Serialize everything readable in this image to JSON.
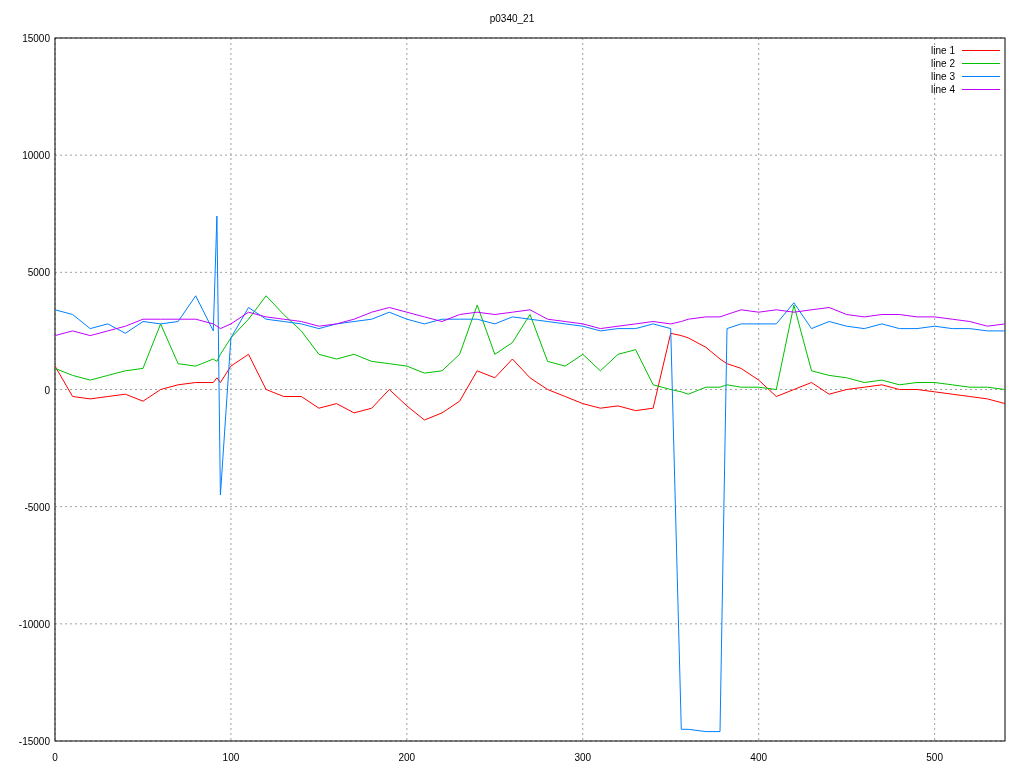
{
  "plot": {
    "chart_data": {
      "type": "line",
      "title": "p0340_21",
      "x": [
        0,
        10,
        20,
        30,
        40,
        50,
        60,
        70,
        80,
        90,
        92,
        94,
        100,
        110,
        120,
        130,
        140,
        150,
        160,
        170,
        180,
        190,
        200,
        210,
        220,
        230,
        240,
        250,
        260,
        270,
        280,
        290,
        300,
        310,
        320,
        330,
        340,
        350,
        356,
        360,
        370,
        378,
        382,
        390,
        400,
        410,
        420,
        430,
        440,
        450,
        460,
        470,
        480,
        490,
        500,
        510,
        520,
        530,
        540
      ],
      "grid": true,
      "legend": true,
      "xlim": [
        0,
        540
      ],
      "ylim": [
        -15000,
        15000
      ],
      "xticks": [
        0,
        100,
        200,
        300,
        400,
        500
      ],
      "yticks": [
        -15000,
        -10000,
        -5000,
        0,
        5000,
        10000,
        15000
      ],
      "series": [
        {
          "name": "line 1",
          "color": "#ff0000",
          "values": [
            1000,
            -300,
            -400,
            -300,
            -200,
            -500,
            0,
            200,
            300,
            300,
            500,
            300,
            1000,
            1500,
            0,
            -300,
            -300,
            -800,
            -600,
            -1000,
            -800,
            0,
            -700,
            -1300,
            -1000,
            -500,
            800,
            500,
            1300,
            500,
            0,
            -300,
            -600,
            -800,
            -700,
            -900,
            -800,
            2400,
            2300,
            2200,
            1800,
            1300,
            1100,
            900,
            400,
            -300,
            0,
            300,
            -200,
            0,
            100,
            200,
            0,
            0,
            -100,
            -200,
            -300,
            -400,
            -600
          ]
        },
        {
          "name": "line 2",
          "color": "#00c000",
          "values": [
            900,
            600,
            400,
            600,
            800,
            900,
            2800,
            1100,
            1000,
            1300,
            1200,
            1500,
            2200,
            3000,
            4000,
            3200,
            2500,
            1500,
            1300,
            1500,
            1200,
            1100,
            1000,
            700,
            800,
            1500,
            3600,
            1500,
            2000,
            3200,
            1200,
            1000,
            1500,
            800,
            1500,
            1700,
            200,
            0,
            -100,
            -200,
            100,
            100,
            200,
            100,
            100,
            0,
            3600,
            800,
            600,
            500,
            300,
            400,
            200,
            300,
            300,
            200,
            100,
            100,
            0
          ]
        },
        {
          "name": "line 3",
          "color": "#0080ff",
          "values": [
            3400,
            3200,
            2600,
            2800,
            2400,
            2900,
            2800,
            2900,
            4000,
            2500,
            7400,
            -4500,
            2200,
            3500,
            3000,
            2900,
            2800,
            2600,
            2800,
            2900,
            3000,
            3300,
            3000,
            2800,
            3000,
            3000,
            3000,
            2800,
            3100,
            3000,
            2900,
            2800,
            2700,
            2500,
            2600,
            2600,
            2800,
            2600,
            -14500,
            -14500,
            -14600,
            -14600,
            2600,
            2800,
            2800,
            2800,
            3700,
            2600,
            2900,
            2700,
            2600,
            2800,
            2600,
            2600,
            2700,
            2600,
            2600,
            2500,
            2500
          ]
        },
        {
          "name": "line 4",
          "color": "#c000ff",
          "values": [
            2300,
            2500,
            2300,
            2500,
            2700,
            3000,
            3000,
            3000,
            3000,
            2800,
            2700,
            2600,
            2800,
            3300,
            3100,
            3000,
            2900,
            2700,
            2800,
            3000,
            3300,
            3500,
            3300,
            3100,
            2900,
            3200,
            3300,
            3200,
            3300,
            3400,
            3000,
            2900,
            2800,
            2600,
            2700,
            2800,
            2900,
            2800,
            2900,
            3000,
            3100,
            3100,
            3200,
            3400,
            3300,
            3400,
            3300,
            3400,
            3500,
            3200,
            3100,
            3200,
            3200,
            3100,
            3100,
            3000,
            2900,
            2700,
            2800
          ]
        }
      ]
    }
  }
}
